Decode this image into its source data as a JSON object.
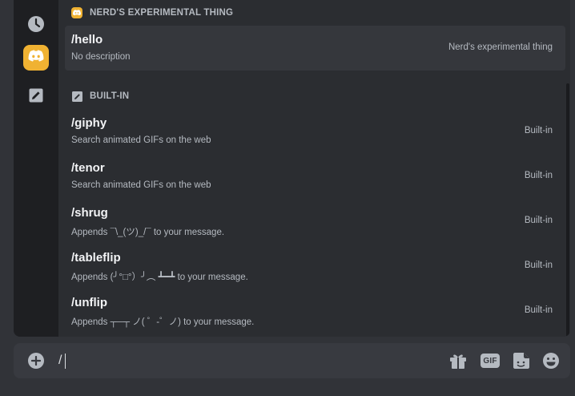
{
  "rail": {
    "items": [
      {
        "icon": "clock-icon"
      },
      {
        "icon": "discord-logo-icon",
        "active": true
      },
      {
        "icon": "pencil-square-icon"
      }
    ]
  },
  "sections": [
    {
      "title": "NERD'S EXPERIMENTAL THING",
      "icon": "discord-logo-icon",
      "commands": [
        {
          "name": "/hello",
          "description": "No description",
          "source": "Nerd's experimental thing",
          "selected": true
        }
      ]
    },
    {
      "title": "BUILT-IN",
      "icon": "pencil-square-icon",
      "commands": [
        {
          "name": "/giphy",
          "description": "Search animated GIFs on the web",
          "source": "Built-in"
        },
        {
          "name": "/tenor",
          "description": "Search animated GIFs on the web",
          "source": "Built-in"
        },
        {
          "name": "/shrug",
          "description": "Appends ¯\\_(ツ)_/¯ to your message.",
          "source": "Built-in"
        },
        {
          "name": "/tableflip",
          "description": "Appends (╯°□°）╯︵ ┻━┻ to your message.",
          "source": "Built-in"
        },
        {
          "name": "/unflip",
          "description": "Appends ┬─┬ ノ( ゜-゜ノ) to your message.",
          "source": "Built-in"
        }
      ]
    }
  ],
  "composer": {
    "value": "/",
    "gif_label": "GIF",
    "icons": [
      "plus-circle-icon",
      "gift-icon",
      "gif-icon",
      "sticker-icon",
      "emoji-icon"
    ]
  },
  "colors": {
    "accent": "#f0b232",
    "background": "#313338",
    "popout": "#2b2d31",
    "rail": "#1e1f22",
    "selected_row": "#35373c",
    "text_primary": "#f2f3f5",
    "text_muted": "#b5bac1"
  }
}
